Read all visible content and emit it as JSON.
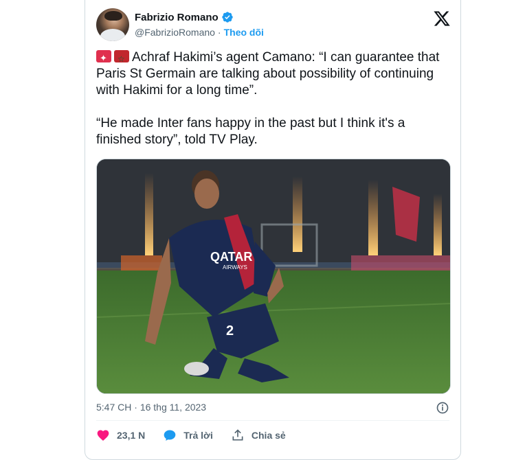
{
  "author": {
    "name": "Fabrizio Romano",
    "handle": "@FabrizioRomano",
    "separator": "·",
    "follow_label": "Theo dõi"
  },
  "tweet": {
    "line1": "Achraf Hakimi’s agent Camano: “I can guarantee that Paris St Germain are talking about possibility of continuing with Hakimi for a long time”.",
    "line2": "“He made Inter fans happy in the past but I think it's a finished story”, told TV Play.",
    "emoji": [
      "siren-emoji",
      "morocco-flag-emoji"
    ]
  },
  "media": {
    "jersey_number": "2",
    "sponsor": "QATAR",
    "sponsor_sub": "AIRWAYS"
  },
  "meta": {
    "time": "5:47 CH",
    "date": "16 thg 11, 2023"
  },
  "actions": {
    "like_count": "23,1 N",
    "reply_label": "Trả lời",
    "share_label": "Chia sẻ"
  },
  "colors": {
    "accent": "#1d9bf0",
    "like": "#f91880",
    "text": "#0f1419",
    "muted": "#536471"
  }
}
